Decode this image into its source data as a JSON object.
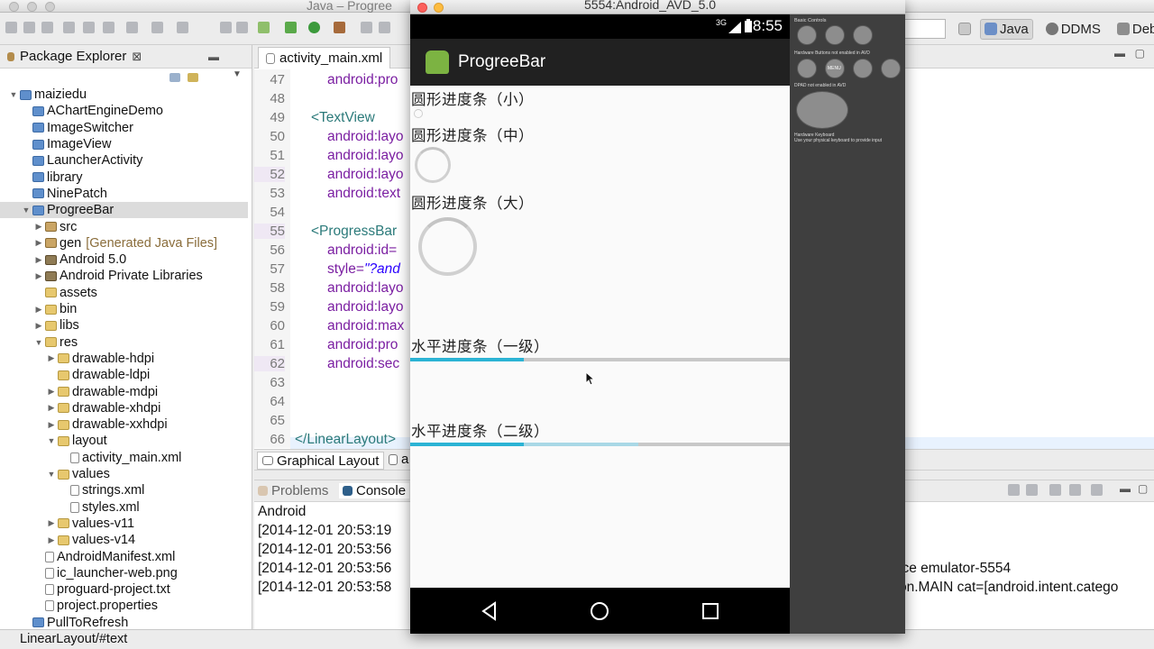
{
  "window": {
    "title": "Java – Progree",
    "emulator_title": "5554:Android_AVD_5.0"
  },
  "perspectives": [
    {
      "label": "Java",
      "active": true
    },
    {
      "label": "DDMS",
      "active": false
    },
    {
      "label": "Debug",
      "active": false
    }
  ],
  "package_explorer": {
    "title": "Package Explorer",
    "items": [
      {
        "label": "maiziedu",
        "depth": 0,
        "twisty": "▼",
        "icon": "project-icon"
      },
      {
        "label": "AChartEngineDemo",
        "depth": 1,
        "twisty": "",
        "icon": "project-icon"
      },
      {
        "label": "ImageSwitcher",
        "depth": 1,
        "twisty": "",
        "icon": "project-icon"
      },
      {
        "label": "ImageView",
        "depth": 1,
        "twisty": "",
        "icon": "project-icon"
      },
      {
        "label": "LauncherActivity",
        "depth": 1,
        "twisty": "",
        "icon": "project-icon"
      },
      {
        "label": "library",
        "depth": 1,
        "twisty": "",
        "icon": "project-icon"
      },
      {
        "label": "NinePatch",
        "depth": 1,
        "twisty": "",
        "icon": "project-icon"
      },
      {
        "label": "ProgreeBar",
        "depth": 1,
        "twisty": "▼",
        "icon": "android-project-icon",
        "selected": true
      },
      {
        "label": "src",
        "depth": 2,
        "twisty": "▶",
        "icon": "source-folder-icon"
      },
      {
        "label": "gen",
        "suffix": "[Generated Java Files]",
        "depth": 2,
        "twisty": "▶",
        "icon": "source-folder-icon"
      },
      {
        "label": "Android 5.0",
        "depth": 2,
        "twisty": "▶",
        "icon": "library-icon"
      },
      {
        "label": "Android Private Libraries",
        "depth": 2,
        "twisty": "▶",
        "icon": "library-icon"
      },
      {
        "label": "assets",
        "depth": 2,
        "twisty": "",
        "icon": "folder-icon"
      },
      {
        "label": "bin",
        "depth": 2,
        "twisty": "▶",
        "icon": "folder-icon"
      },
      {
        "label": "libs",
        "depth": 2,
        "twisty": "▶",
        "icon": "folder-icon"
      },
      {
        "label": "res",
        "depth": 2,
        "twisty": "▼",
        "icon": "folder-icon"
      },
      {
        "label": "drawable-hdpi",
        "depth": 3,
        "twisty": "▶",
        "icon": "folder-icon"
      },
      {
        "label": "drawable-ldpi",
        "depth": 3,
        "twisty": "",
        "icon": "folder-icon"
      },
      {
        "label": "drawable-mdpi",
        "depth": 3,
        "twisty": "▶",
        "icon": "folder-icon"
      },
      {
        "label": "drawable-xhdpi",
        "depth": 3,
        "twisty": "▶",
        "icon": "folder-icon"
      },
      {
        "label": "drawable-xxhdpi",
        "depth": 3,
        "twisty": "▶",
        "icon": "folder-icon"
      },
      {
        "label": "layout",
        "depth": 3,
        "twisty": "▼",
        "icon": "folder-icon"
      },
      {
        "label": "activity_main.xml",
        "depth": 4,
        "twisty": "",
        "icon": "xml-file-icon"
      },
      {
        "label": "values",
        "depth": 3,
        "twisty": "▼",
        "icon": "folder-icon"
      },
      {
        "label": "strings.xml",
        "depth": 4,
        "twisty": "",
        "icon": "xml-file-icon"
      },
      {
        "label": "styles.xml",
        "depth": 4,
        "twisty": "",
        "icon": "xml-file-icon"
      },
      {
        "label": "values-v11",
        "depth": 3,
        "twisty": "▶",
        "icon": "folder-icon"
      },
      {
        "label": "values-v14",
        "depth": 3,
        "twisty": "▶",
        "icon": "folder-icon"
      },
      {
        "label": "AndroidManifest.xml",
        "depth": 2,
        "twisty": "",
        "icon": "xml-file-icon"
      },
      {
        "label": "ic_launcher-web.png",
        "depth": 2,
        "twisty": "",
        "icon": "image-file-icon"
      },
      {
        "label": "proguard-project.txt",
        "depth": 2,
        "twisty": "",
        "icon": "text-file-icon"
      },
      {
        "label": "project.properties",
        "depth": 2,
        "twisty": "",
        "icon": "text-file-icon"
      },
      {
        "label": "PullToRefresh",
        "depth": 1,
        "twisty": "",
        "icon": "project-icon"
      }
    ]
  },
  "editor": {
    "tab": "activity_main.xml",
    "lines": [
      {
        "n": "47",
        "indent": 2,
        "parts": [
          {
            "t": "attr",
            "s": "android:pro"
          }
        ]
      },
      {
        "n": "48",
        "indent": 0,
        "parts": []
      },
      {
        "n": "49",
        "indent": 1,
        "parts": [
          {
            "t": "tag",
            "s": "<TextView"
          }
        ]
      },
      {
        "n": "50",
        "indent": 2,
        "parts": [
          {
            "t": "attr",
            "s": "android:layo"
          }
        ]
      },
      {
        "n": "51",
        "indent": 2,
        "parts": [
          {
            "t": "attr",
            "s": "android:layo"
          }
        ]
      },
      {
        "n": "52",
        "indent": 2,
        "parts": [
          {
            "t": "attr",
            "s": "android:layo"
          }
        ],
        "mod": true
      },
      {
        "n": "53",
        "indent": 2,
        "parts": [
          {
            "t": "attr",
            "s": "android:text"
          }
        ]
      },
      {
        "n": "54",
        "indent": 0,
        "parts": []
      },
      {
        "n": "55",
        "indent": 1,
        "parts": [
          {
            "t": "tag",
            "s": "<ProgressBar"
          }
        ],
        "mod": true
      },
      {
        "n": "56",
        "indent": 2,
        "parts": [
          {
            "t": "attr",
            "s": "android:id="
          }
        ]
      },
      {
        "n": "57",
        "indent": 2,
        "parts": [
          {
            "t": "attr",
            "s": "style="
          },
          {
            "t": "val",
            "s": "\"?and"
          }
        ]
      },
      {
        "n": "58",
        "indent": 2,
        "parts": [
          {
            "t": "attr",
            "s": "android:layo"
          }
        ]
      },
      {
        "n": "59",
        "indent": 2,
        "parts": [
          {
            "t": "attr",
            "s": "android:layo"
          }
        ]
      },
      {
        "n": "60",
        "indent": 2,
        "parts": [
          {
            "t": "attr",
            "s": "android:max"
          }
        ]
      },
      {
        "n": "61",
        "indent": 2,
        "parts": [
          {
            "t": "attr",
            "s": "android:pro"
          }
        ]
      },
      {
        "n": "62",
        "indent": 2,
        "parts": [
          {
            "t": "attr",
            "s": "android:sec"
          }
        ],
        "mod": true
      },
      {
        "n": "63",
        "indent": 0,
        "parts": []
      },
      {
        "n": "64",
        "indent": 0,
        "parts": [],
        "current": true
      },
      {
        "n": "65",
        "indent": 0,
        "parts": []
      },
      {
        "n": "66",
        "indent": 0,
        "parts": [
          {
            "t": "tag",
            "s": "</LinearLayout>"
          }
        ]
      }
    ],
    "bottom_tabs": [
      "Graphical Layout",
      "a"
    ]
  },
  "console": {
    "tabs": [
      "Problems",
      "Console"
    ],
    "header": "Android",
    "lines": [
      "[2014-12-01 20:53:19",
      "[2014-12-01 20:53:56",
      "[2014-12-01 20:53:56",
      "[2014-12-01 20:53:58"
    ],
    "right_fragments": [
      "ice emulator-5554",
      "on.MAIN cat=[android.intent.catego"
    ]
  },
  "status_bar": {
    "text": "LinearLayout/#text"
  },
  "phone": {
    "status": {
      "network": "3G",
      "time": "8:55"
    },
    "app_title": "ProgreeBar",
    "labels": {
      "small": "圆形进度条（小）",
      "medium": "圆形进度条（中）",
      "large": "圆形进度条（大）",
      "h1": "水平进度条（一级）",
      "h2": "水平进度条（二级）"
    },
    "horizontal": [
      {
        "progress": 0.3,
        "secondary": 0.3
      },
      {
        "progress": 0.3,
        "secondary": 0.6
      }
    ]
  },
  "controls": {
    "basic": "Basic Controls",
    "hardware": "Hardware Buttons not enabled in AVD",
    "dpad": "DPAD not enabled in AVD",
    "keyboard": "Hardware Keyboard",
    "keyboard_hint": "Use your physical keyboard to provide input",
    "menu": "MENU"
  },
  "colors": {
    "accent": "#2bb3d4",
    "secondary": "#a9d8e6",
    "track": "#c8c8c8",
    "action_bar": "#212121"
  }
}
